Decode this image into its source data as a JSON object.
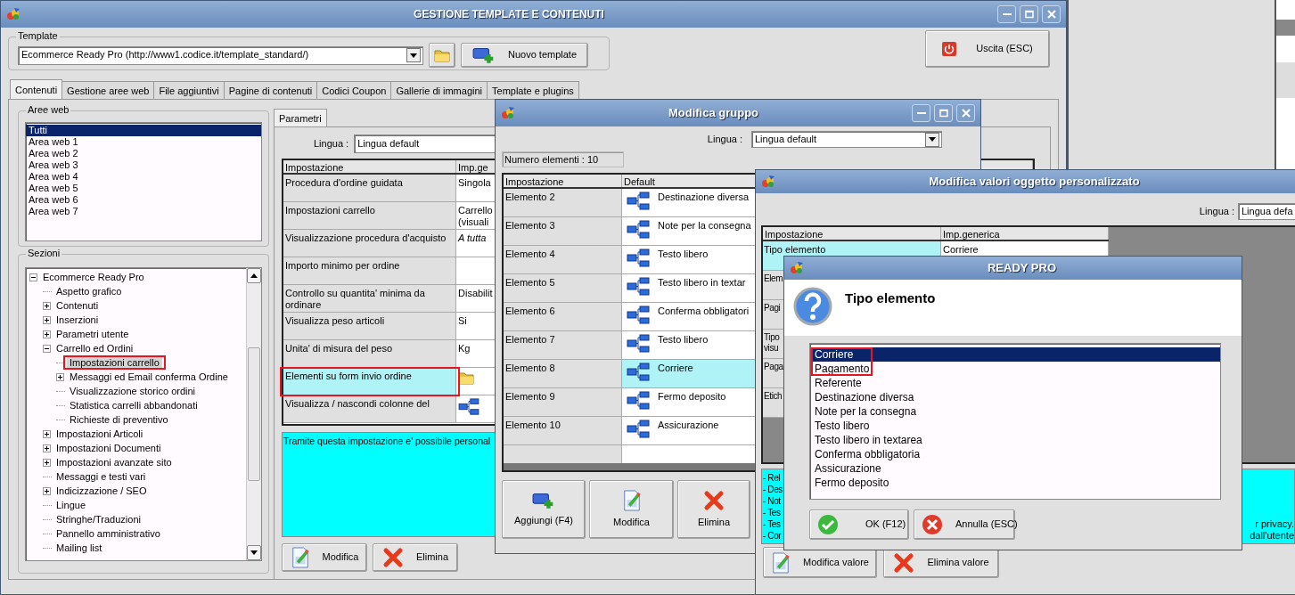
{
  "main_window": {
    "title": "GESTIONE TEMPLATE E CONTENUTI",
    "template": {
      "label": "Template",
      "value": "Ecommerce Ready Pro (http://www1.codice.it/template_standard/)",
      "new_button": "Nuovo template"
    },
    "exit_button": "Uscita (ESC)",
    "tabs": [
      {
        "label": "Contenuti",
        "selected": true
      },
      {
        "label": "Gestione aree web",
        "selected": false
      },
      {
        "label": "File aggiuntivi",
        "selected": false
      },
      {
        "label": "Pagine di contenuti",
        "selected": false
      },
      {
        "label": "Codici Coupon",
        "selected": false
      },
      {
        "label": "Gallerie di immagini",
        "selected": false
      },
      {
        "label": "Template e plugins",
        "selected": false
      }
    ],
    "web_areas": {
      "title": "Aree web",
      "items": [
        {
          "label": "Tutti",
          "selected": true
        },
        {
          "label": "Area web 1",
          "selected": false
        },
        {
          "label": "Area web 2",
          "selected": false
        },
        {
          "label": "Area web 3",
          "selected": false
        },
        {
          "label": "Area web 4",
          "selected": false
        },
        {
          "label": "Area web 5",
          "selected": false
        },
        {
          "label": "Area web 6",
          "selected": false
        },
        {
          "label": "Area web 7",
          "selected": false
        }
      ]
    },
    "sections": {
      "title": "Sezioni",
      "tree": [
        {
          "label": "Ecommerce Ready Pro",
          "expanded": true,
          "selected": false,
          "highlighted": false,
          "children": [
            {
              "label": "Aspetto grafico",
              "selected": false,
              "highlighted": false
            },
            {
              "label": "Contenuti",
              "expanded": false,
              "selected": false,
              "highlighted": false
            },
            {
              "label": "Inserzioni",
              "expanded": false,
              "selected": false,
              "highlighted": false
            },
            {
              "label": "Parametri utente",
              "expanded": false,
              "selected": false,
              "highlighted": false
            },
            {
              "label": "Carrello ed Ordini",
              "expanded": true,
              "selected": false,
              "highlighted": false,
              "children": [
                {
                  "label": "Impostazioni carrello",
                  "selected": true,
                  "highlighted": true
                },
                {
                  "label": "Messaggi ed Email conferma Ordine",
                  "expanded": false,
                  "selected": false,
                  "highlighted": false
                },
                {
                  "label": "Visualizzazione storico ordini",
                  "selected": false,
                  "highlighted": false
                },
                {
                  "label": "Statistica carrelli abbandonati",
                  "selected": false,
                  "highlighted": false
                },
                {
                  "label": "Richieste di preventivo",
                  "selected": false,
                  "highlighted": false
                }
              ]
            },
            {
              "label": "Impostazioni Articoli",
              "expanded": false,
              "selected": false,
              "highlighted": false
            },
            {
              "label": "Impostazioni Documenti",
              "expanded": false,
              "selected": false,
              "highlighted": false
            },
            {
              "label": "Impostazioni avanzate sito",
              "expanded": false,
              "selected": false,
              "highlighted": false
            },
            {
              "label": "Messaggi e testi vari",
              "selected": false,
              "highlighted": false
            },
            {
              "label": "Indicizzazione / SEO",
              "expanded": false,
              "selected": false,
              "highlighted": false
            },
            {
              "label": "Lingue",
              "selected": false,
              "highlighted": false
            },
            {
              "label": "Stringhe/Traduzioni",
              "selected": false,
              "highlighted": false
            },
            {
              "label": "Pannello amministrativo",
              "selected": false,
              "highlighted": false
            },
            {
              "label": "Mailing list",
              "selected": false,
              "highlighted": false
            }
          ]
        }
      ]
    },
    "panel_tab": "Parametri",
    "language": {
      "label": "Lingua :",
      "value": "Lingua default"
    },
    "grid": {
      "columns": [
        "Impostazione",
        "Imp.ge"
      ],
      "rows": [
        {
          "setting": "Procedura d'ordine guidata",
          "value": "Singola",
          "kind": "text",
          "selected": false,
          "highlighted": false
        },
        {
          "setting": "Impostazioni carrello",
          "value": "Carrello\n(visuali",
          "kind": "text",
          "selected": false,
          "highlighted": false
        },
        {
          "setting": "Visualizzazione procedura d'acquisto",
          "value": "A tutta",
          "kind": "italic",
          "selected": false,
          "highlighted": false
        },
        {
          "setting": "Importo minimo per ordine",
          "kind": "text",
          "selected": false,
          "highlighted": false
        },
        {
          "setting": "Controllo su quantita' minima da ordinare",
          "value": "Disabilit",
          "kind": "text",
          "selected": false,
          "highlighted": false
        },
        {
          "setting": "Visualizza peso articoli",
          "value": "Si",
          "kind": "text",
          "selected": false,
          "highlighted": false
        },
        {
          "setting": "Unita' di misura del peso",
          "value": "Kg",
          "kind": "text",
          "selected": false,
          "highlighted": false
        },
        {
          "setting": "Elementi su form invio ordine",
          "kind": "folder",
          "selected": true,
          "highlighted": true
        },
        {
          "setting": "Visualizza / nascondi colonne del",
          "kind": "hierarchy",
          "selected": false,
          "highlighted": false
        }
      ]
    },
    "description": "Tramite questa impostazione e' possibile personal",
    "buttons": [
      {
        "label": "Modifica",
        "kind": "edit"
      },
      {
        "label": "Elimina",
        "kind": "delete"
      }
    ]
  },
  "group_dialog": {
    "title": "Modifica gruppo",
    "language": {
      "label": "Lingua :",
      "value": "Lingua default"
    },
    "count": "Numero elementi : 10",
    "columns": [
      "Impostazione",
      "Default"
    ],
    "rows": [
      {
        "setting": "Elemento 2",
        "value": "Destinazione diversa",
        "selected": false
      },
      {
        "setting": "Elemento 3",
        "value": "Note per la consegna",
        "selected": false
      },
      {
        "setting": "Elemento 4",
        "value": "Testo libero",
        "selected": false
      },
      {
        "setting": "Elemento 5",
        "value": "Testo libero in textar",
        "selected": false
      },
      {
        "setting": "Elemento 6",
        "value": "Conferma obbligatori",
        "selected": false
      },
      {
        "setting": "Elemento 7",
        "value": "Testo libero",
        "selected": false
      },
      {
        "setting": "Elemento 8",
        "value": "Corriere",
        "selected": true
      },
      {
        "setting": "Elemento 9",
        "value": "Fermo deposito",
        "selected": false
      },
      {
        "setting": "Elemento 10",
        "value": "Assicurazione",
        "selected": false
      }
    ],
    "buttons": [
      {
        "label": "Aggiungi (F4)",
        "kind": "add"
      },
      {
        "label": "Modifica",
        "kind": "edit"
      },
      {
        "label": "Elimina",
        "kind": "delete"
      }
    ]
  },
  "values_dialog": {
    "title": "Modifica valori oggetto personalizzato",
    "language": {
      "label": "Lingua :",
      "value": "Lingua defa"
    },
    "columns": [
      "Impostazione",
      "Imp.generica"
    ],
    "rows": [
      {
        "setting": "Tipo elemento",
        "value": "Corriere",
        "selected": true
      },
      {
        "setting": "Elem",
        "selected": false
      },
      {
        "setting": "Pagi",
        "selected": false
      },
      {
        "setting": "Tipo\nvisu",
        "selected": false
      },
      {
        "setting": "Paga",
        "selected": false
      },
      {
        "setting": "Etich",
        "selected": false
      }
    ],
    "description_lines": [
      {
        "start": "- Rel"
      },
      {
        "start": "- Des"
      },
      {
        "start": "- Not"
      },
      {
        "start": "- Tes"
      },
      {
        "start": "- Tes",
        "end": "r privacy."
      },
      {
        "start": "- Cor",
        "end": "dall'utente"
      }
    ],
    "buttons": [
      {
        "label": "Modifica valore",
        "kind": "edit"
      },
      {
        "label": "Elimina valore",
        "kind": "delete"
      }
    ]
  },
  "prompt_dialog": {
    "title": "READY PRO",
    "heading": "Tipo elemento",
    "options": [
      {
        "label": "Corriere",
        "selected": true,
        "highlighted": true
      },
      {
        "label": "Pagamento",
        "selected": false,
        "highlighted": true
      },
      {
        "label": "Referente",
        "selected": false,
        "highlighted": false
      },
      {
        "label": "Destinazione diversa",
        "selected": false,
        "highlighted": false
      },
      {
        "label": "Note per la consegna",
        "selected": false,
        "highlighted": false
      },
      {
        "label": "Testo libero",
        "selected": false,
        "highlighted": false
      },
      {
        "label": "Testo libero in textarea",
        "selected": false,
        "highlighted": false
      },
      {
        "label": "Conferma obbligatoria",
        "selected": false,
        "highlighted": false
      },
      {
        "label": "Assicurazione",
        "selected": false,
        "highlighted": false
      },
      {
        "label": "Fermo deposito",
        "selected": false,
        "highlighted": false
      }
    ],
    "buttons": [
      {
        "label": "OK (F12)",
        "kind": "ok"
      },
      {
        "label": "Annulla (ESC)",
        "kind": "cancel"
      }
    ]
  }
}
